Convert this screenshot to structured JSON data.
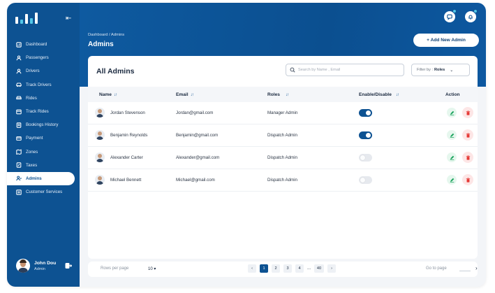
{
  "sidebar": {
    "items": [
      {
        "label": "Dashboard",
        "icon": "dashboard-icon"
      },
      {
        "label": "Passengers",
        "icon": "passenger-icon"
      },
      {
        "label": "Drivers",
        "icon": "driver-icon"
      },
      {
        "label": "Track Drivers",
        "icon": "car-icon"
      },
      {
        "label": "Rides",
        "icon": "ride-icon"
      },
      {
        "label": "Track Rides",
        "icon": "route-icon"
      },
      {
        "label": "Bookings History",
        "icon": "history-icon"
      },
      {
        "label": "Payment",
        "icon": "payment-icon"
      },
      {
        "label": "Zones",
        "icon": "zone-icon"
      },
      {
        "label": "Taxes",
        "icon": "taxes-icon"
      },
      {
        "label": "Admins",
        "icon": "admins-icon",
        "active": true
      },
      {
        "label": "Customer Services",
        "icon": "customer-service-icon"
      }
    ],
    "user": {
      "name": "John Dou",
      "role": "Admin"
    }
  },
  "header": {
    "breadcrumb": "Dashboard / Admins",
    "title": "Admins",
    "add_button": "+ Add New Admin"
  },
  "table": {
    "title": "All Admins",
    "search_placeholder": "Search by Name , Email",
    "filter_label": "Filter by :",
    "filter_value": "Roles",
    "columns": {
      "name": "Name",
      "email": "Email",
      "roles": "Roles",
      "enable": "Enable/Disable",
      "action": "Action"
    },
    "rows": [
      {
        "name": "Jordan Stevenson",
        "email": "Jordan@gmail.com",
        "role": "Manager Admin",
        "enabled": true
      },
      {
        "name": "Benjamin Reynolds",
        "email": "Benjamin@gmail.com",
        "role": "Dispatch Admin",
        "enabled": true
      },
      {
        "name": "Alexander Carter",
        "email": "Alexander@gmail.com",
        "role": "Dispatch Admin",
        "enabled": false
      },
      {
        "name": "Michael Bennett",
        "email": "Michael@gmail.com",
        "role": "Dispatch Admin",
        "enabled": false
      }
    ]
  },
  "pagination": {
    "rows_per_page_label": "Rows per page",
    "rows_per_page": "10",
    "pages": [
      "1",
      "2",
      "3",
      "4"
    ],
    "ellipsis": "...",
    "last_page": "40",
    "current": "1",
    "goto_label": "Go to page"
  },
  "colors": {
    "primary": "#0d5292",
    "accent": "#52c7e8",
    "edit": "#1aa35c",
    "delete": "#e53935"
  }
}
